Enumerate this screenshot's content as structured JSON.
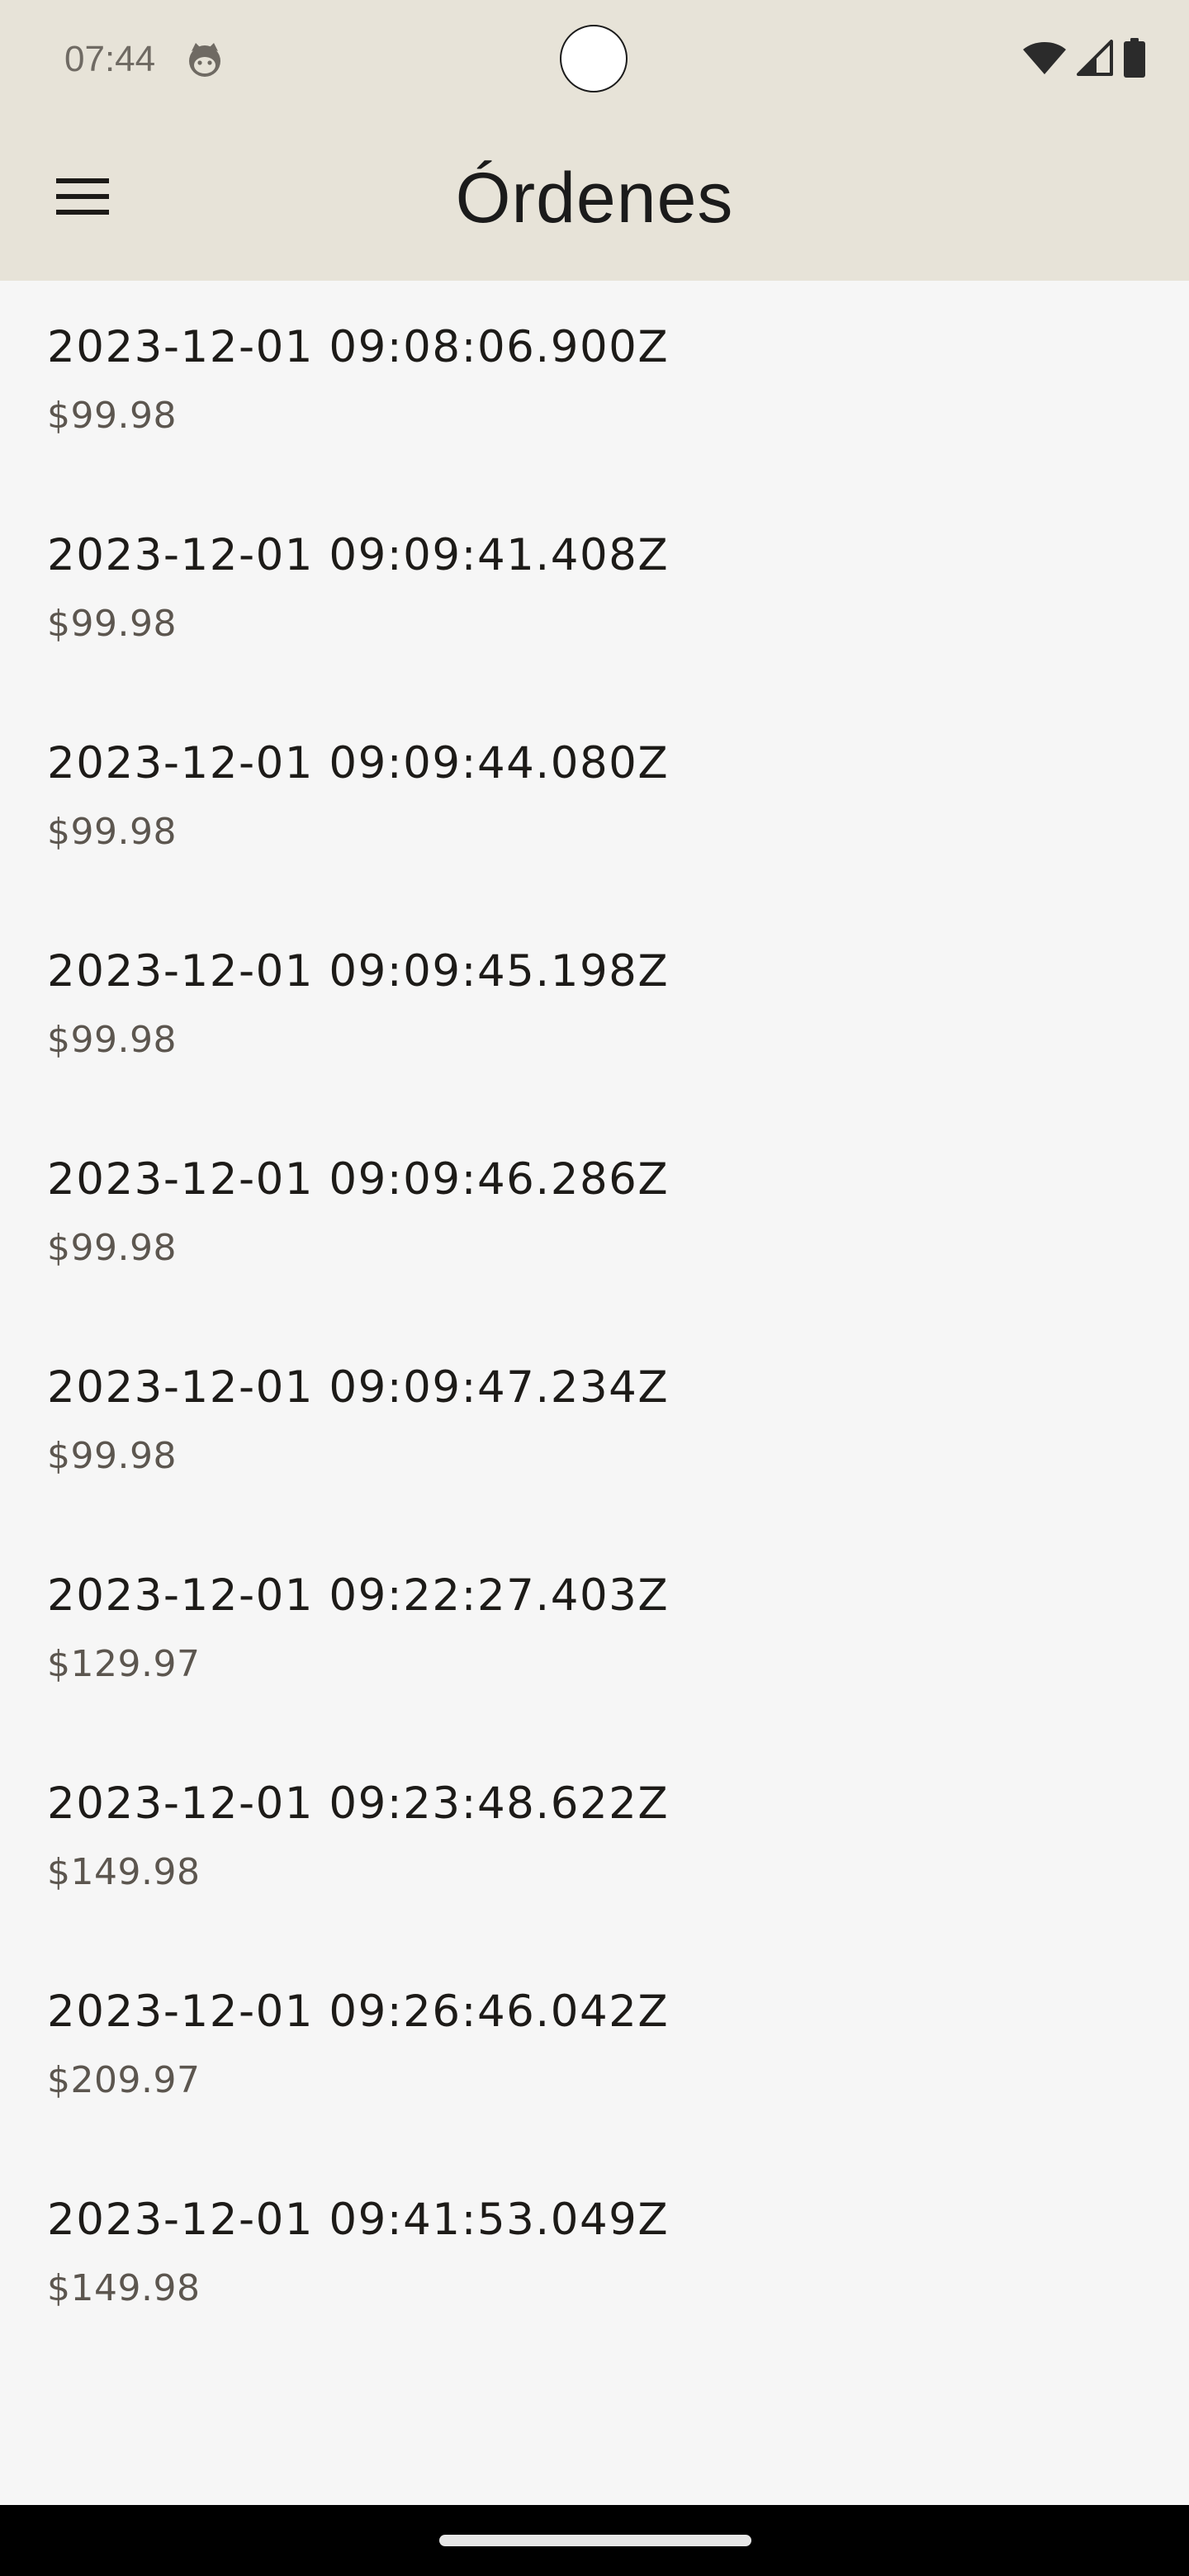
{
  "status_bar": {
    "time": "07:44",
    "icons": [
      "cat-notification-icon",
      "wifi-icon",
      "signal-icon",
      "battery-icon"
    ]
  },
  "header": {
    "title": "Órdenes",
    "menu_icon": "hamburger-menu-icon"
  },
  "orders": [
    {
      "date": "2023-12-01 09:08:06.900Z",
      "total": "$99.98"
    },
    {
      "date": "2023-12-01 09:09:41.408Z",
      "total": "$99.98"
    },
    {
      "date": "2023-12-01 09:09:44.080Z",
      "total": "$99.98"
    },
    {
      "date": "2023-12-01 09:09:45.198Z",
      "total": "$99.98"
    },
    {
      "date": "2023-12-01 09:09:46.286Z",
      "total": "$99.98"
    },
    {
      "date": "2023-12-01 09:09:47.234Z",
      "total": "$99.98"
    },
    {
      "date": "2023-12-01 09:22:27.403Z",
      "total": "$129.97"
    },
    {
      "date": "2023-12-01 09:23:48.622Z",
      "total": "$149.98"
    },
    {
      "date": "2023-12-01 09:26:46.042Z",
      "total": "$209.97"
    },
    {
      "date": "2023-12-01 09:41:53.049Z",
      "total": "$149.98"
    }
  ],
  "colors": {
    "top_bar": "#e7e3d8",
    "background": "#f6f6f6",
    "primary_text": "#1d1b18",
    "secondary_text": "#5c564f"
  }
}
